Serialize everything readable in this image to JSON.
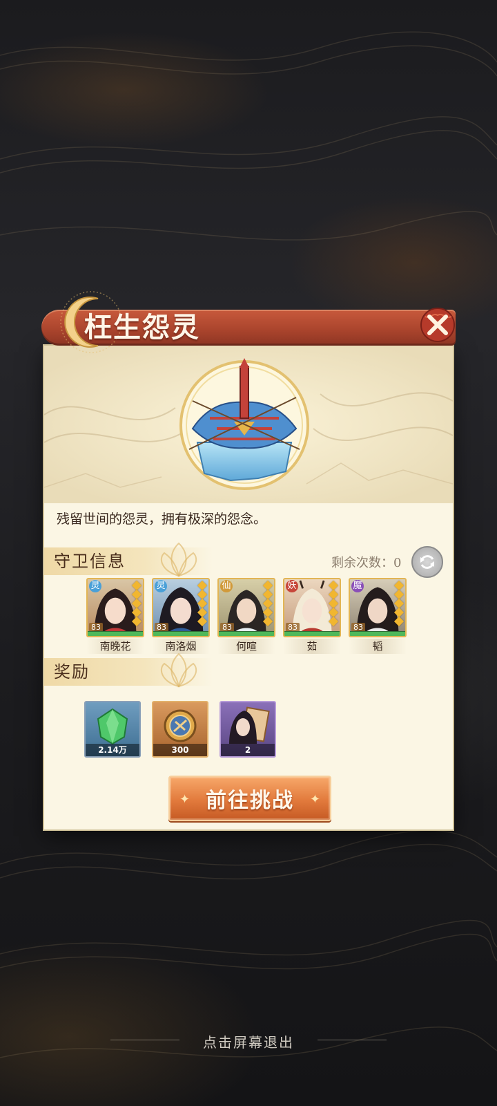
{
  "dialog": {
    "title": "枉生怨灵",
    "description": "残留世间的怨灵，拥有极深的怨念。"
  },
  "guards_section": {
    "label": "守卫信息",
    "remaining_label": "剩余次数：",
    "remaining_value": "0",
    "guards": [
      {
        "name": "南晚花",
        "level": "83",
        "element": "灵"
      },
      {
        "name": "南洛烟",
        "level": "83",
        "element": "灵"
      },
      {
        "name": "何喧",
        "level": "83",
        "element": "仙"
      },
      {
        "name": "茹",
        "level": "83",
        "element": "妖"
      },
      {
        "name": "韬",
        "level": "83",
        "element": "魔"
      }
    ]
  },
  "rewards_section": {
    "label": "奖励",
    "items": [
      {
        "icon": "green-gem-icon",
        "count": "2.14万"
      },
      {
        "icon": "bronze-coin-icon",
        "count": "300"
      },
      {
        "icon": "character-card-icon",
        "count": "2"
      }
    ]
  },
  "actions": {
    "challenge_label": "前往挑战",
    "exit_hint": "点击屏幕退出"
  },
  "colors": {
    "header": "#b04a30",
    "panel": "#fbf6e4",
    "button": "#e27a3c"
  }
}
